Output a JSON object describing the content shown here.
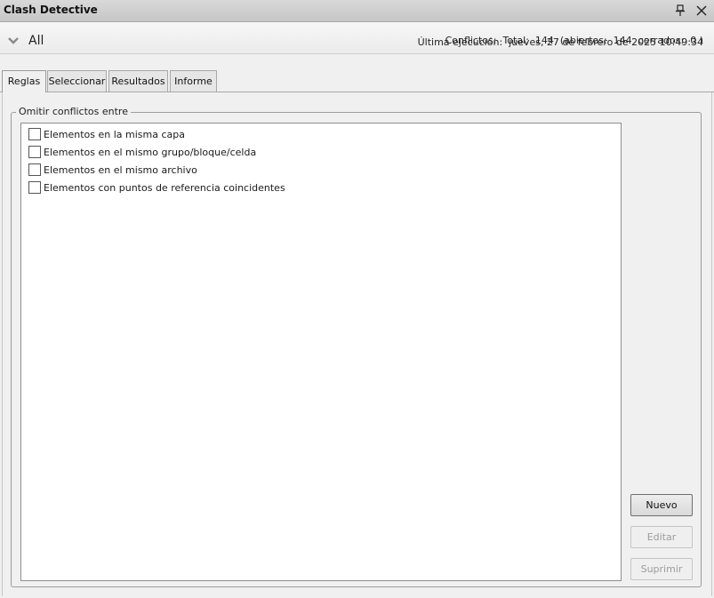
{
  "window": {
    "title": "Clash Detective",
    "pin_icon": "pin-icon",
    "close_icon": "close-icon"
  },
  "header": {
    "test_name": "All",
    "last_run": "Última ejecución:  jueves, 27 de febrero de 2025 10:49:34",
    "conflicts": "Conflictos:  Total:  144  (abiertos:  144  cerrados:  0 )"
  },
  "tabs": [
    {
      "label": "Reglas",
      "active": true
    },
    {
      "label": "Seleccionar",
      "active": false
    },
    {
      "label": "Resultados",
      "active": false
    },
    {
      "label": "Informe",
      "active": false
    }
  ],
  "rules": {
    "group_label": "Omitir conflictos entre",
    "items": [
      {
        "label": "Elementos en la misma capa",
        "checked": false
      },
      {
        "label": "Elementos en el mismo grupo/bloque/celda",
        "checked": false
      },
      {
        "label": "Elementos en el mismo archivo",
        "checked": false
      },
      {
        "label": "Elementos con puntos de referencia coincidentes",
        "checked": false
      }
    ]
  },
  "buttons": {
    "new": "Nuevo",
    "edit": "Editar",
    "delete": "Suprimir"
  }
}
